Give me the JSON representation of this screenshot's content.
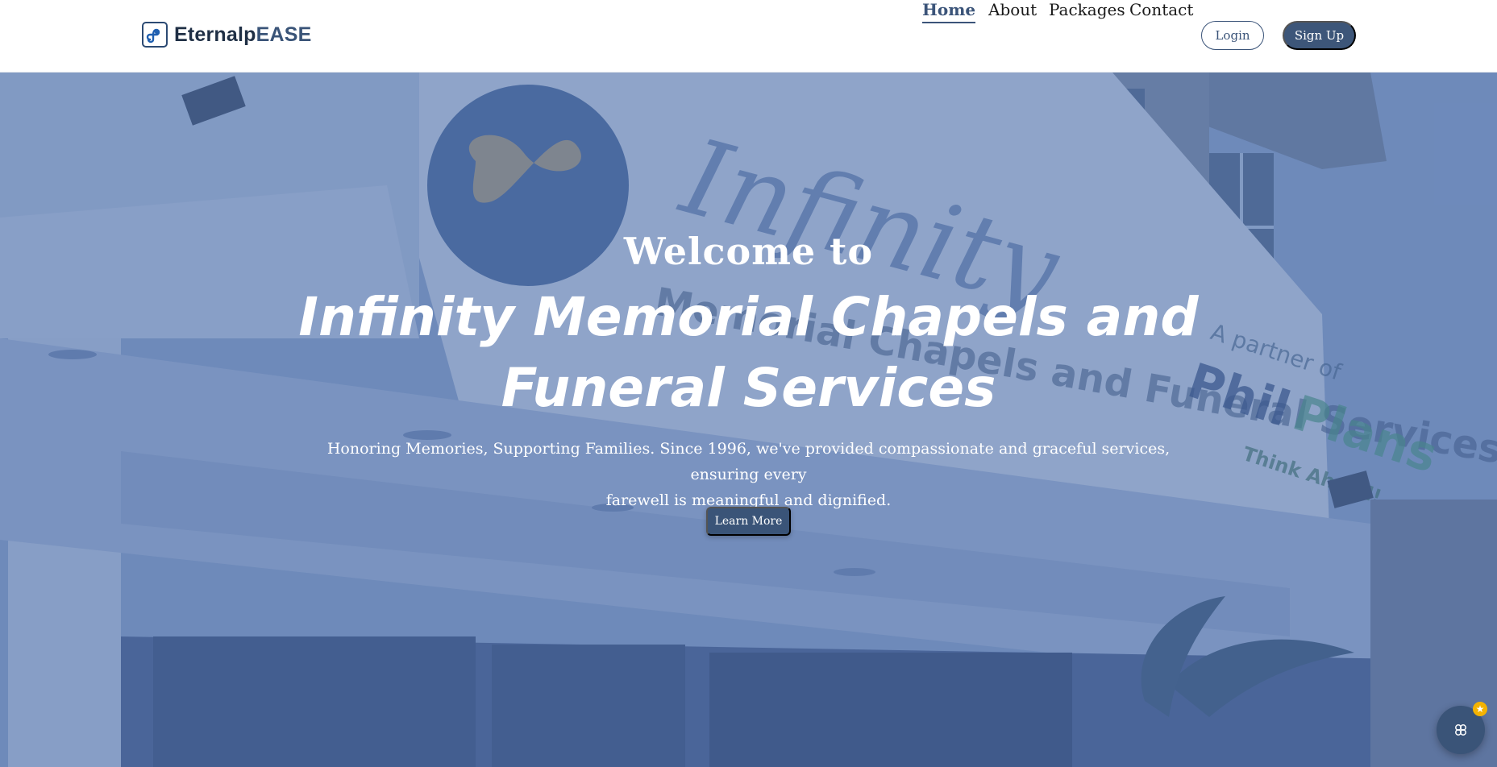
{
  "brand": {
    "name_part1": "Eternalp",
    "name_part2": "EASE",
    "logo_icon": "infinity-logo-icon"
  },
  "nav": {
    "links": [
      {
        "label": "Home",
        "active": true
      },
      {
        "label": "About",
        "active": false
      },
      {
        "label": "Packages",
        "active": false
      },
      {
        "label": "Contact",
        "active": false
      }
    ],
    "login_label": "Login",
    "signup_label": "Sign Up"
  },
  "hero": {
    "welcome": "Welcome to",
    "title_line1": "Infinity Memorial Chapels and",
    "title_line2": "Funeral Services",
    "subtitle_line1": "Honoring Memories, Supporting Families. Since 1996, we've provided compassionate and graceful services, ensuring every",
    "subtitle_line2": "farewell is meaningful and dignified.",
    "cta_label": "Learn More",
    "background_description_sign": "Infinity",
    "background_sign_subtitle": "Memorial Chapels and Funeral Services",
    "background_partner_text": "A partner of",
    "background_partner_brand_1": "Phil",
    "background_partner_brand_2": "Plans",
    "background_partner_tagline": "Think Ahead!"
  },
  "chat": {
    "icon": "chat-bot-icon",
    "badge_icon": "star-icon"
  },
  "colors": {
    "primary": "#3b5479",
    "overlay": "#5373aa",
    "badge": "#f5b301"
  }
}
